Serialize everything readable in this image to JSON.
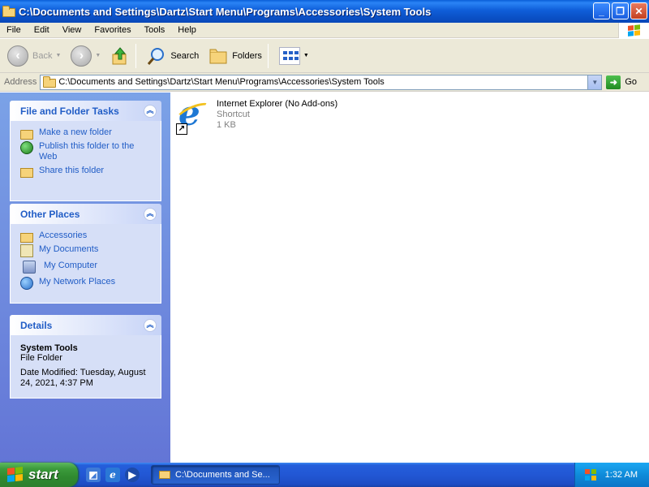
{
  "window": {
    "title": "C:\\Documents and Settings\\Dartz\\Start Menu\\Programs\\Accessories\\System Tools",
    "minimize": "_",
    "maximize": "❐",
    "close": "✕"
  },
  "menu": [
    "File",
    "Edit",
    "View",
    "Favorites",
    "Tools",
    "Help"
  ],
  "toolbar": {
    "back_label": "Back",
    "search_label": "Search",
    "folders_label": "Folders"
  },
  "address": {
    "label": "Address",
    "value": "C:\\Documents and Settings\\Dartz\\Start Menu\\Programs\\Accessories\\System Tools",
    "go_label": "Go"
  },
  "panels": {
    "tasks": {
      "title": "File and Folder Tasks",
      "items": [
        "Make a new folder",
        "Publish this folder to the Web",
        "Share this folder"
      ]
    },
    "places": {
      "title": "Other Places",
      "items": [
        "Accessories",
        "My Documents",
        "My Computer",
        "My Network Places"
      ]
    },
    "details": {
      "title": "Details",
      "name": "System Tools",
      "type": "File Folder",
      "modified": "Date Modified: Tuesday, August 24, 2021, 4:37 PM"
    }
  },
  "files": [
    {
      "name": "Internet Explorer (No Add-ons)",
      "type": "Shortcut",
      "size": "1 KB"
    }
  ],
  "taskbar": {
    "start_label": "start",
    "task_label": "C:\\Documents and Se...",
    "time": "1:32 AM"
  },
  "colors": {
    "titlebar": "#0a5fd8",
    "panel_link": "#215dc6",
    "start_green": "#3c9b3c",
    "taskbar_blue": "#245edb"
  }
}
